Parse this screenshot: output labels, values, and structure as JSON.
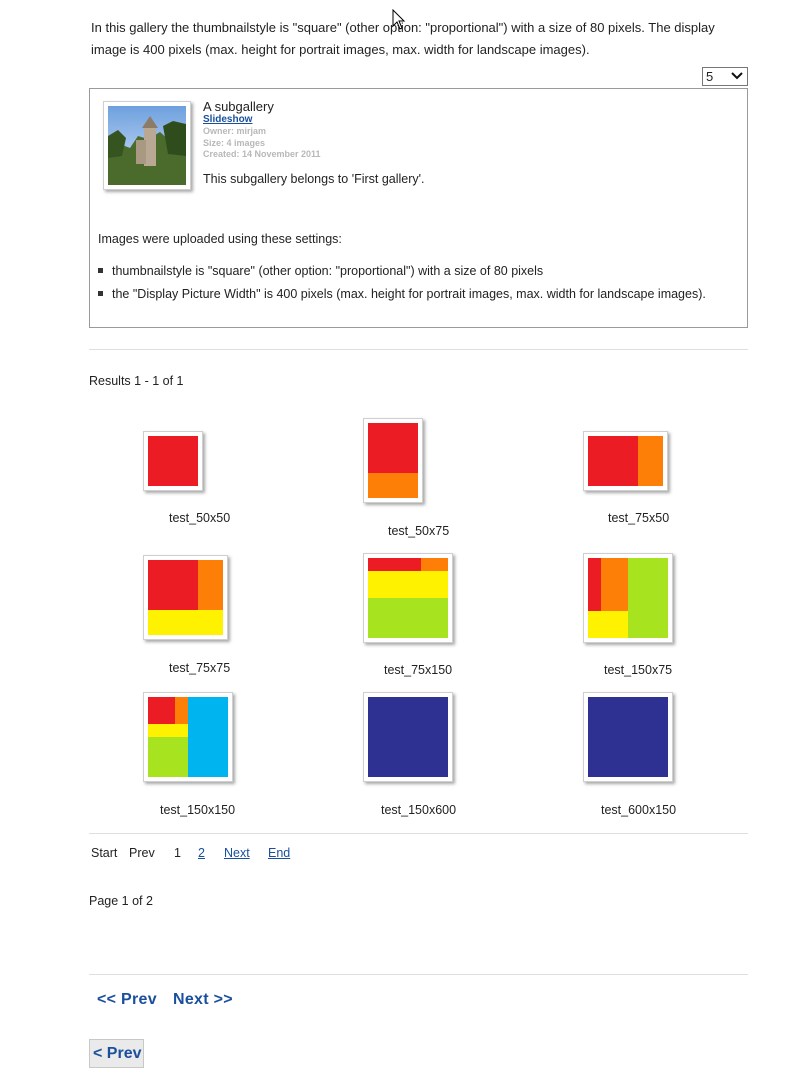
{
  "intro": {
    "text": "In this gallery the thumbnailstyle is \"square\" (other option: \"proportional\") with a size of 80 pixels. The display image is 400 pixels (max. height for portrait images, max. width for landscape images)."
  },
  "per_page_select": {
    "value": "5"
  },
  "subgallery": {
    "title": "A subgallery",
    "slideshow_link": "Slideshow",
    "owner": "Owner: mirjam",
    "size": "Size: 4 images",
    "created": "Created: 14 November 2011",
    "description": "This subgallery belongs to 'First gallery'.",
    "settings_intro": "Images were uploaded using these settings:",
    "bullets": [
      "thumbnailstyle is \"square\" (other option: \"proportional\") with a size of 80 pixels",
      "the \"Display Picture Width\" is 400 pixels (max. height for portrait images, max. width for landscape images)."
    ]
  },
  "results_text": "Results 1 - 1 of 1",
  "images": [
    {
      "caption": "test_50x50"
    },
    {
      "caption": "test_50x75"
    },
    {
      "caption": "test_75x50"
    },
    {
      "caption": "test_75x75"
    },
    {
      "caption": "test_75x150"
    },
    {
      "caption": "test_150x75"
    },
    {
      "caption": "test_150x150"
    },
    {
      "caption": "test_150x600"
    },
    {
      "caption": "test_600x150"
    }
  ],
  "pagination": {
    "start": "Start",
    "prev": "Prev",
    "current": "1",
    "page2": "2",
    "next": "Next",
    "end": "End"
  },
  "page_info": "Page 1 of 2",
  "nav": {
    "prev_prev": "<< Prev",
    "next_next": "Next >>",
    "prev_single": "< Prev"
  },
  "colors": {
    "red": "#ec1c24",
    "orange": "#fd7f08",
    "yellow": "#fef200",
    "green": "#a8e31f",
    "blue": "#00b5ef",
    "navy": "#2e3192",
    "link": "#1a4f9c"
  }
}
